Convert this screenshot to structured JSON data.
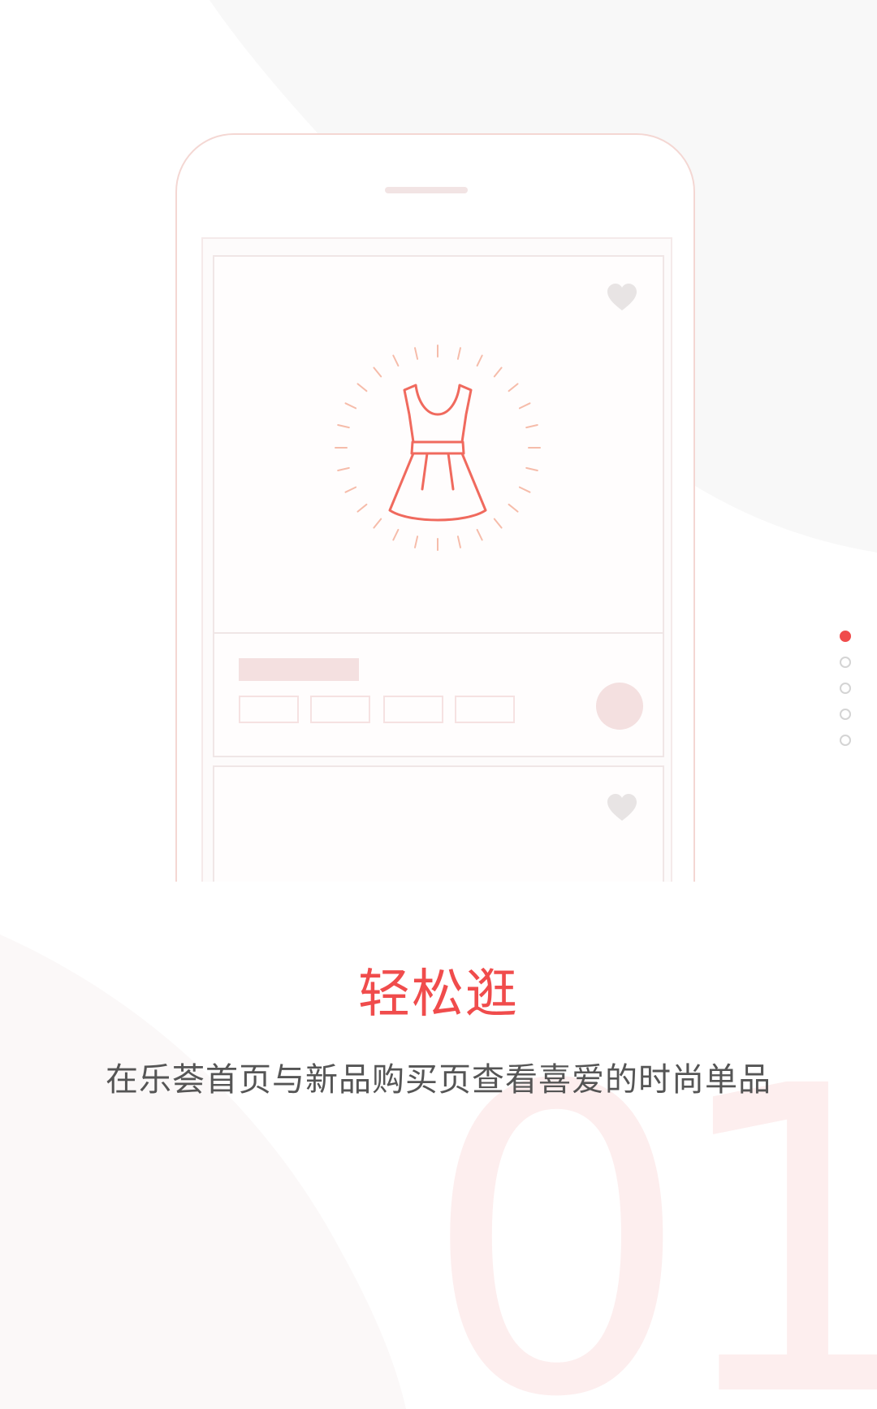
{
  "onboarding": {
    "step_number": "01",
    "headline": "轻松逛",
    "subtitle": "在乐荟首页与新品购买页查看喜爱的时尚单品",
    "total_pages": 5,
    "current_page": 1
  },
  "phone_mockup": {
    "cards": [
      {
        "icon": "dress-icon",
        "favorite_icon": "heart-icon",
        "tag_count": 4
      },
      {
        "favorite_icon": "heart-icon"
      }
    ]
  },
  "colors": {
    "accent": "#f04c4c",
    "subtitle_text": "#555555",
    "big_number": "#fdeeee",
    "phone_outline": "#f4d7d3",
    "background_shape": "#f8f8f8"
  }
}
